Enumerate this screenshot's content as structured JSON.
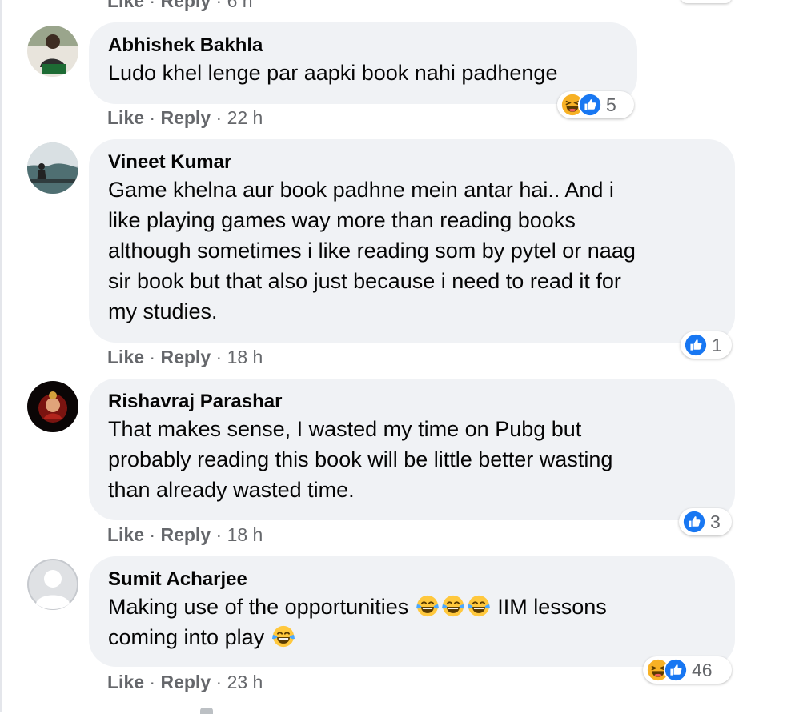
{
  "top_fragment": {
    "like": "Like",
    "reply": "Reply",
    "time": "6 h"
  },
  "comments": [
    {
      "author": "Abhishek Bakhla",
      "lines": [
        "Ludo khel lenge par aapki book nahi padhenge"
      ],
      "like": "Like",
      "reply": "Reply",
      "time": "22 h",
      "reactions": [
        "haha",
        "like"
      ],
      "reaction_count": "5"
    },
    {
      "author": "Vineet Kumar",
      "lines": [
        "Game khelna aur book padhne mein antar hai.. And i",
        "like playing games way more than reading books",
        "although sometimes i like reading som by pytel or naag",
        "sir book but that also just because i need to read it for",
        "my studies."
      ],
      "like": "Like",
      "reply": "Reply",
      "time": "18 h",
      "reactions": [
        "like"
      ],
      "reaction_count": "1"
    },
    {
      "author": "Rishavraj Parashar",
      "lines": [
        "That makes sense, I wasted my time on Pubg but",
        "probably reading this book will be little better wasting",
        "than already wasted time."
      ],
      "like": "Like",
      "reply": "Reply",
      "time": "18 h",
      "reactions": [
        "like"
      ],
      "reaction_count": "3"
    },
    {
      "author": "Sumit Acharjee",
      "line1": "Making use of the opportunities",
      "line1_emojis": [
        "laughing-crying",
        "laughing-crying",
        "laughing-crying"
      ],
      "line1_after": "IIM lessons",
      "line2": "coming into play",
      "line2_emojis": [
        "laughing-crying"
      ],
      "like": "Like",
      "reply": "Reply",
      "time": "23 h",
      "reactions": [
        "haha",
        "like"
      ],
      "reaction_count": "46"
    }
  ],
  "colors": {
    "bubble": "#f0f2f5",
    "meta_text": "#65676b",
    "like_blue": "#1877f2",
    "haha_yellow": "#f7b125"
  }
}
